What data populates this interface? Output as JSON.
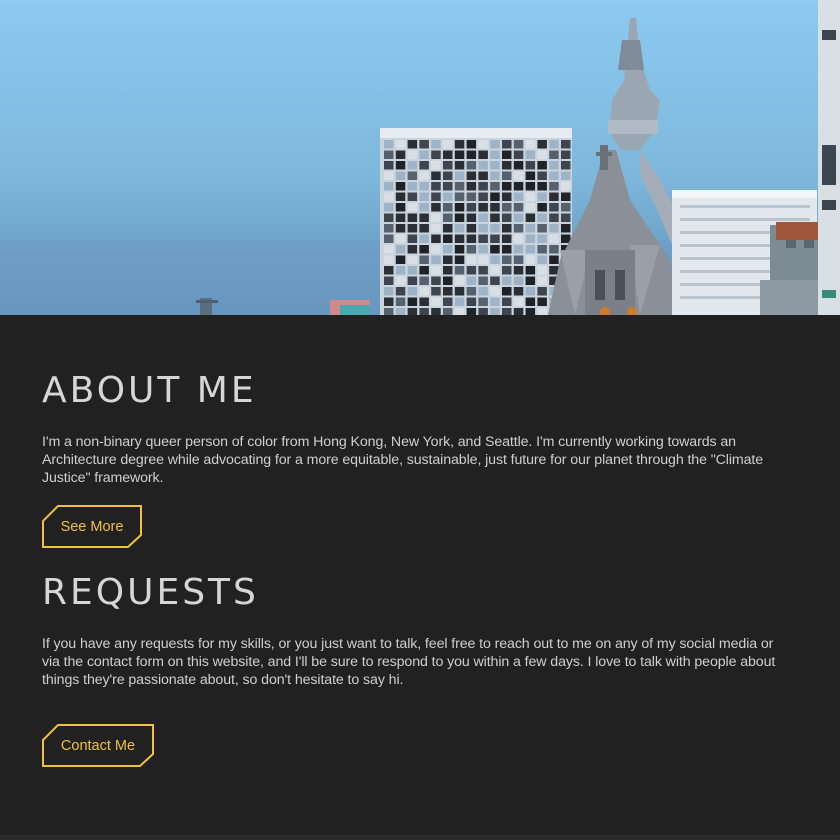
{
  "hero": {
    "alt_subject": "voxel-city-skyline"
  },
  "about": {
    "title": "ABOUT ME",
    "text": "I'm a non-binary queer person of color from Hong Kong, New York, and Seattle. I'm currently working towards an Architecture degree while advocating for a more equitable, sustainable, just future for our planet through the \"Climate Justice\" framework.",
    "button_label": "See More"
  },
  "requests": {
    "title": "REQUESTS",
    "text": "If you have any requests for my skills, or you just want to talk, feel free to reach out to me on any of my social media or via the contact form on this website, and I'll be sure to respond to you within a few days. I love to talk with people about things they're passionate about, so don't hesitate to say hi.",
    "button_label": "Contact Me"
  },
  "colors": {
    "background": "#202020",
    "text": "#cfcfcf",
    "accent": "#f0c040"
  }
}
